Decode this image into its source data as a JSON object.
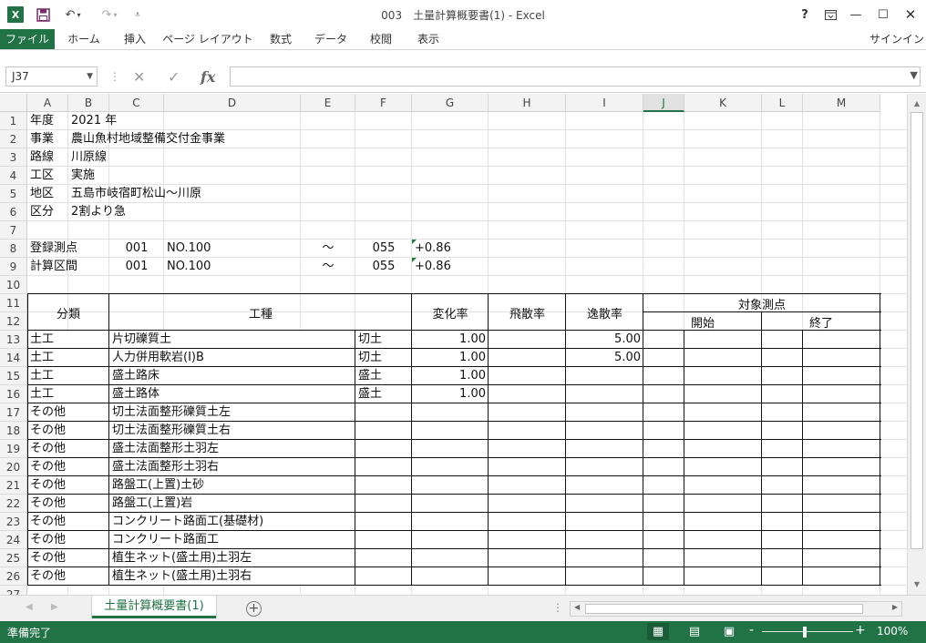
{
  "app": {
    "title": "003　土量計算概要書(1) - Excel",
    "icons": [
      "excel-logo",
      "save-icon",
      "undo-icon",
      "redo-icon",
      "customize-icon",
      "help-icon",
      "ribbon-display-icon",
      "minimize-icon",
      "maximize-icon",
      "close-icon"
    ]
  },
  "ribbon": {
    "tabs": [
      "ファイル",
      "ホーム",
      "挿入",
      "ページ レイアウト",
      "数式",
      "データ",
      "校閲",
      "表示"
    ],
    "signin": "サインイン"
  },
  "formula_bar": {
    "name_box": "J37",
    "fx": "fx",
    "value": ""
  },
  "columns": [
    "A",
    "B",
    "C",
    "D",
    "E",
    "F",
    "G",
    "H",
    "I",
    "J",
    "K",
    "L",
    "M"
  ],
  "active_column": "J",
  "rows": [
    "1",
    "2",
    "3",
    "4",
    "5",
    "6",
    "7",
    "8",
    "9",
    "10",
    "11",
    "12",
    "13",
    "14",
    "15",
    "16",
    "17",
    "18",
    "19",
    "20",
    "21",
    "22",
    "23",
    "24",
    "25",
    "26",
    "27"
  ],
  "info": [
    {
      "label": "年度",
      "value": "2021 年"
    },
    {
      "label": "事業",
      "value": "農山魚村地域整備交付金事業"
    },
    {
      "label": "路線",
      "value": "川原線"
    },
    {
      "label": "工区",
      "value": "実施"
    },
    {
      "label": "地区",
      "value": "五島市岐宿町松山～川原"
    },
    {
      "label": "区分",
      "value": "2割より急"
    }
  ],
  "stations": [
    {
      "label": "登録測点",
      "c": "001",
      "d": "NO.100",
      "e": "～",
      "f": "055",
      "g": "+0.86"
    },
    {
      "label": "計算区間",
      "c": "001",
      "d": "NO.100",
      "e": "～",
      "f": "055",
      "g": "+0.86"
    }
  ],
  "table_header": {
    "category": "分類",
    "work_type": "工種",
    "change_rate": "変化率",
    "scatter_rate": "飛散率",
    "escape_rate": "逸散率",
    "target_points": "対象測点",
    "start": "開始",
    "end": "終了"
  },
  "table_rows": [
    {
      "category": "土工",
      "work": "片切礫質土",
      "type": "切土",
      "change": "1.00",
      "scatter": "",
      "escape": "5.00"
    },
    {
      "category": "土工",
      "work": "人力併用軟岩(Ⅰ)B",
      "type": "切土",
      "change": "1.00",
      "scatter": "",
      "escape": "5.00"
    },
    {
      "category": "土工",
      "work": "盛土路床",
      "type": "盛土",
      "change": "1.00",
      "scatter": "",
      "escape": ""
    },
    {
      "category": "土工",
      "work": "盛土路体",
      "type": "盛土",
      "change": "1.00",
      "scatter": "",
      "escape": ""
    },
    {
      "category": "その他",
      "work": "切土法面整形礫質土左",
      "type": "",
      "change": "",
      "scatter": "",
      "escape": ""
    },
    {
      "category": "その他",
      "work": "切土法面整形礫質土右",
      "type": "",
      "change": "",
      "scatter": "",
      "escape": ""
    },
    {
      "category": "その他",
      "work": "盛土法面整形土羽左",
      "type": "",
      "change": "",
      "scatter": "",
      "escape": ""
    },
    {
      "category": "その他",
      "work": "盛土法面整形土羽右",
      "type": "",
      "change": "",
      "scatter": "",
      "escape": ""
    },
    {
      "category": "その他",
      "work": "路盤工(上置)土砂",
      "type": "",
      "change": "",
      "scatter": "",
      "escape": ""
    },
    {
      "category": "その他",
      "work": "路盤工(上置)岩",
      "type": "",
      "change": "",
      "scatter": "",
      "escape": ""
    },
    {
      "category": "その他",
      "work": "コンクリート路面工(基礎材)",
      "type": "",
      "change": "",
      "scatter": "",
      "escape": ""
    },
    {
      "category": "その他",
      "work": "コンクリート路面工",
      "type": "",
      "change": "",
      "scatter": "",
      "escape": ""
    },
    {
      "category": "その他",
      "work": "植生ネット(盛土用)土羽左",
      "type": "",
      "change": "",
      "scatter": "",
      "escape": ""
    },
    {
      "category": "その他",
      "work": "植生ネット(盛土用)土羽右",
      "type": "",
      "change": "",
      "scatter": "",
      "escape": ""
    }
  ],
  "sheet_tabs": [
    "土量計算概要書(1)"
  ],
  "status": {
    "text": "準備完了",
    "zoom": "100%",
    "zoom_minus": "-",
    "zoom_plus": "+"
  }
}
